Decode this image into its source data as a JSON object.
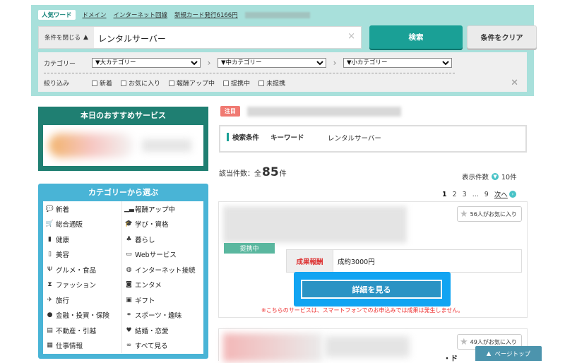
{
  "search": {
    "popular_tag": "人気ワード",
    "popular_links": [
      "ドメイン",
      "インターネット回線",
      "新規カード発行6166円"
    ],
    "close_conditions": "条件を閉じる",
    "keyword_value": "レンタルサーバー",
    "search_button": "検索",
    "clear_button": "条件をクリア",
    "category_label": "カテゴリー",
    "category_selects": [
      "▼大カテゴリー",
      "▼中カテゴリー",
      "▼小カテゴリー"
    ],
    "narrow_label": "絞り込み",
    "narrow_options": [
      "新着",
      "お気に入り",
      "報酬アップ中",
      "提携中",
      "未提携"
    ]
  },
  "sidebar": {
    "recommend_title": "本日のおすすめサービス",
    "category_title": "カテゴリーから選ぶ",
    "categories": [
      {
        "label": "新着",
        "icon": "chat-bubble-icon"
      },
      {
        "label": "報酬アップ中",
        "icon": "bar-chart-icon"
      },
      {
        "label": "総合通販",
        "icon": "cart-icon"
      },
      {
        "label": "学び・資格",
        "icon": "graduation-cap-icon"
      },
      {
        "label": "健康",
        "icon": "bottle-icon"
      },
      {
        "label": "暮らし",
        "icon": "tree-icon"
      },
      {
        "label": "美容",
        "icon": "cosmetics-icon"
      },
      {
        "label": "Webサービス",
        "icon": "monitor-icon"
      },
      {
        "label": "グルメ・食品",
        "icon": "fork-knife-icon"
      },
      {
        "label": "インターネット接続",
        "icon": "globe-icon"
      },
      {
        "label": "ファッション",
        "icon": "dress-icon"
      },
      {
        "label": "エンタメ",
        "icon": "camera-icon"
      },
      {
        "label": "旅行",
        "icon": "plane-icon"
      },
      {
        "label": "ギフト",
        "icon": "gift-icon"
      },
      {
        "label": "金融・投資・保険",
        "icon": "money-bag-icon"
      },
      {
        "label": "スポーツ・趣味",
        "icon": "bone-icon"
      },
      {
        "label": "不動産・引越",
        "icon": "truck-icon"
      },
      {
        "label": "結婚・恋愛",
        "icon": "heart-icon"
      },
      {
        "label": "仕事情報",
        "icon": "briefcase-icon"
      },
      {
        "label": "すべて見る",
        "icon": "binoculars-icon"
      }
    ]
  },
  "main": {
    "notice_badge": "注目",
    "condition_label": "検索条件",
    "condition_key": "キーワード",
    "condition_value": "レンタルサーバー",
    "count_prefix": "該当件数：全",
    "count_value": "85",
    "count_suffix": "件",
    "display_count_label": "表示件数",
    "display_count_value": "10件",
    "pager": {
      "current": "1",
      "pages": [
        "2",
        "3",
        "...",
        "9"
      ],
      "next": "次へ"
    },
    "cards": [
      {
        "status": "提携中",
        "favorites": "56人がお気に入り",
        "reward_label": "成果報酬",
        "reward_value": "成約3000円",
        "detail_button": "詳細を見る",
        "note": "※こちらのサービスは、スマートフォンでのお申込みでは成果は発生しません。"
      },
      {
        "favorites": "49人がお気に入り",
        "fragment": "・ド"
      }
    ],
    "page_top": "ページトップ"
  },
  "colors": {
    "panel_bg": "#a8e0db",
    "teal_button": "#1aa096",
    "sidebar_green": "#1f7f72",
    "sidebar_blue": "#49b4d6",
    "highlight_blue": "#11a4f2",
    "status_green": "#5ab79f",
    "alert_red": "#e33333"
  }
}
